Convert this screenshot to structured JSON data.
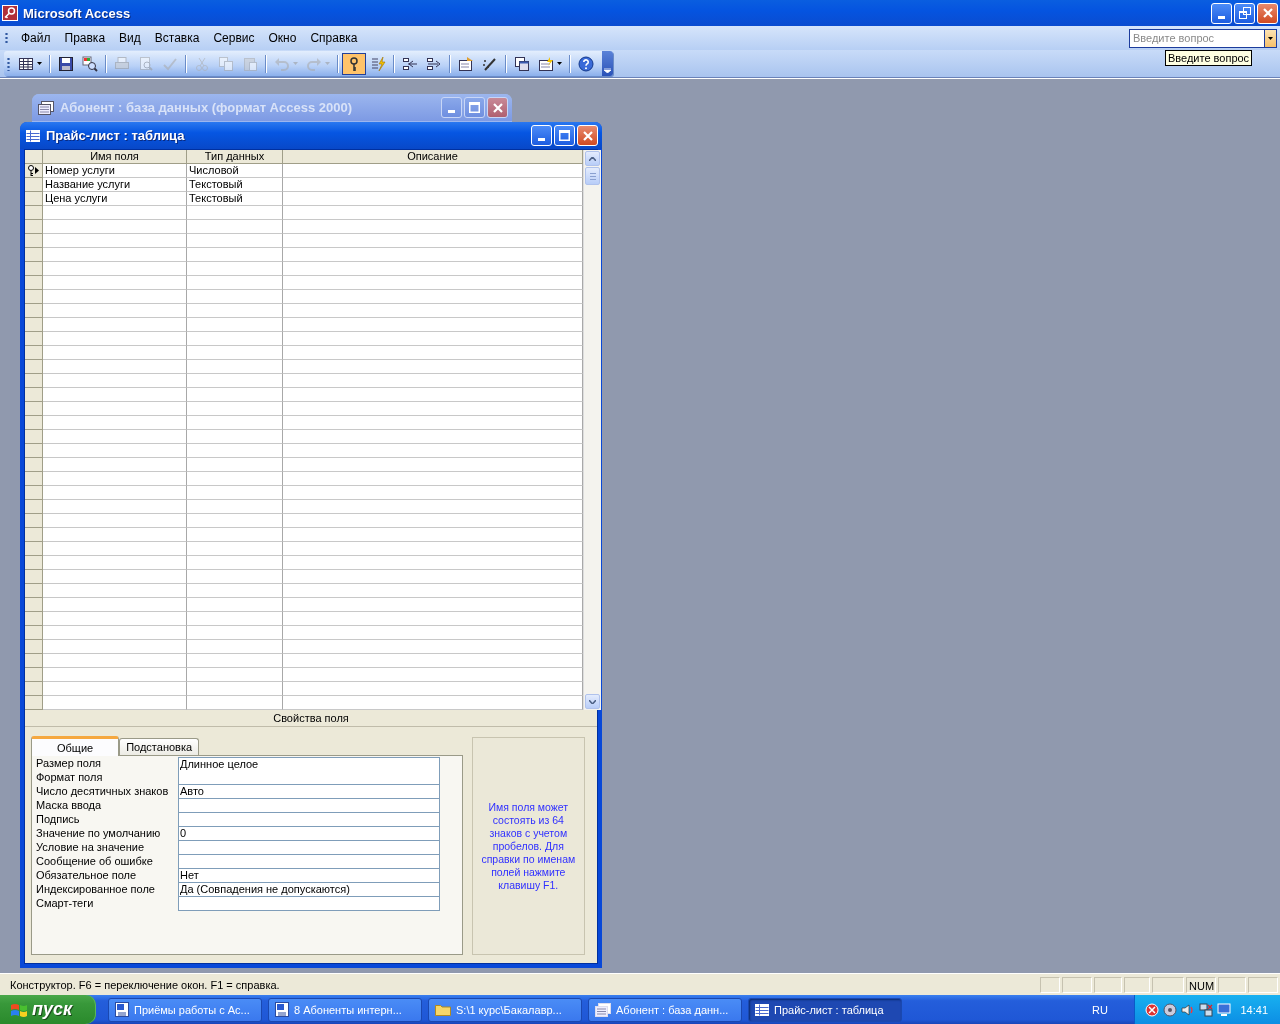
{
  "app": {
    "title": "Microsoft Access"
  },
  "menu": [
    {
      "label": "Файл"
    },
    {
      "label": "Правка"
    },
    {
      "label": "Вид"
    },
    {
      "label": "Вставка"
    },
    {
      "label": "Сервис"
    },
    {
      "label": "Окно"
    },
    {
      "label": "Справка"
    }
  ],
  "help_box": {
    "placeholder": "Введите вопрос",
    "tooltip": "Введите вопрос"
  },
  "toolbar": [
    {
      "kind": "button",
      "disabled": false,
      "pressed": false,
      "dropdown": true
    },
    {
      "kind": "separator"
    },
    {
      "kind": "button",
      "disabled": false,
      "pressed": false,
      "dropdown": false
    },
    {
      "kind": "button",
      "disabled": false,
      "pressed": false,
      "dropdown": false
    },
    {
      "kind": "separator"
    },
    {
      "kind": "button",
      "disabled": true,
      "pressed": false,
      "dropdown": false
    },
    {
      "kind": "button",
      "disabled": true,
      "pressed": false,
      "dropdown": false
    },
    {
      "kind": "button",
      "disabled": true,
      "pressed": false,
      "dropdown": false
    },
    {
      "kind": "separator"
    },
    {
      "kind": "button",
      "disabled": true,
      "pressed": false,
      "dropdown": false
    },
    {
      "kind": "button",
      "disabled": true,
      "pressed": false,
      "dropdown": false
    },
    {
      "kind": "button",
      "disabled": true,
      "pressed": false,
      "dropdown": false
    },
    {
      "kind": "separator"
    },
    {
      "kind": "button",
      "disabled": true,
      "pressed": false,
      "dropdown": true
    },
    {
      "kind": "button",
      "disabled": true,
      "pressed": false,
      "dropdown": true
    },
    {
      "kind": "separator"
    },
    {
      "kind": "button",
      "disabled": false,
      "pressed": true,
      "dropdown": false
    },
    {
      "kind": "button",
      "disabled": false,
      "pressed": false,
      "dropdown": false
    },
    {
      "kind": "separator"
    },
    {
      "kind": "button",
      "disabled": false,
      "pressed": false,
      "dropdown": false
    },
    {
      "kind": "button",
      "disabled": false,
      "pressed": false,
      "dropdown": false
    },
    {
      "kind": "separator"
    },
    {
      "kind": "button",
      "disabled": false,
      "pressed": false,
      "dropdown": false
    },
    {
      "kind": "button",
      "disabled": false,
      "pressed": false,
      "dropdown": false
    },
    {
      "kind": "separator"
    },
    {
      "kind": "button",
      "disabled": false,
      "pressed": false,
      "dropdown": false
    },
    {
      "kind": "button",
      "disabled": false,
      "pressed": false,
      "dropdown": true
    },
    {
      "kind": "separator"
    },
    {
      "kind": "button",
      "disabled": false,
      "pressed": false,
      "dropdown": false
    }
  ],
  "db_window": {
    "title": "Абонент : база данных (формат Access 2000)",
    "active": false
  },
  "table_window": {
    "title": "Прайс-лист : таблица",
    "active": true,
    "columns": [
      "Имя поля",
      "Тип данных",
      "Описание"
    ],
    "fields": [
      {
        "name": "Номер услуги",
        "type": "Числовой",
        "primary_key": true,
        "current": true
      },
      {
        "name": "Название услуги",
        "type": "Текстовый",
        "primary_key": false,
        "current": false
      },
      {
        "name": "Цена услуги",
        "type": "Текстовый",
        "primary_key": false,
        "current": false
      }
    ],
    "properties_label": "Свойства поля",
    "tabs": [
      {
        "label": "Общие",
        "selected": true
      },
      {
        "label": "Подстановка",
        "selected": false
      }
    ],
    "properties": [
      {
        "label": "Размер поля",
        "value": "Длинное целое"
      },
      {
        "label": "Формат поля"
      },
      {
        "label": "Число десятичных знаков",
        "value": "Авто"
      },
      {
        "label": "Маска ввода"
      },
      {
        "label": "Подпись"
      },
      {
        "label": "Значение по умолчанию",
        "value": "0"
      },
      {
        "label": "Условие на значение"
      },
      {
        "label": "Сообщение об ошибке"
      },
      {
        "label": "Обязательное поле",
        "value": "Нет"
      },
      {
        "label": "Индексированное поле",
        "value": "Да (Совпадения не допускаются)"
      },
      {
        "label": "Смарт-теги"
      }
    ],
    "help_text": "Имя поля может состоять из 64 знаков с учетом пробелов.  Для справки по именам полей нажмите клавишу F1."
  },
  "status_bar": {
    "text": "Конструктор.  F6 = переключение окон.  F1 = справка.",
    "indicator": "NUM"
  },
  "taskbar": {
    "start": "пуск",
    "tasks": [
      {
        "label": "Приёмы работы с Ac...",
        "kind": "document",
        "selected": false
      },
      {
        "label": "8 Абоненты интерн...",
        "kind": "document",
        "selected": false
      },
      {
        "label": "S:\\1 курс\\Бакалавр...",
        "kind": "folder",
        "selected": false
      },
      {
        "label": "Абонент : база данн...",
        "kind": "database",
        "selected": false
      },
      {
        "label": "Прайс-лист : таблица",
        "kind": "table",
        "selected": true
      }
    ],
    "language": "RU",
    "clock": "14:41"
  }
}
